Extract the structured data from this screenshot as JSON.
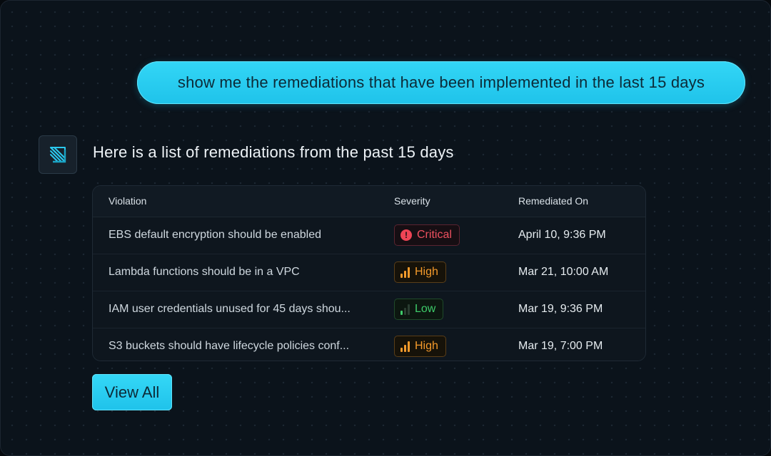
{
  "user_message": "show me the remediations that have been implemented in the last 15 days",
  "assistant": {
    "avatar_icon": "stripes-logo-icon",
    "message": "Here is a list of remediations from the past 15 days"
  },
  "table": {
    "columns": [
      "Violation",
      "Severity",
      "Remediated On"
    ],
    "rows": [
      {
        "violation": "EBS default encryption should be enabled",
        "severity": "Critical",
        "severity_icon": "alert-circle-icon",
        "remediated_on": "April 10, 9:36 PM"
      },
      {
        "violation": "Lambda functions should be in a VPC",
        "severity": "High",
        "severity_icon": "signal-high-icon",
        "remediated_on": "Mar 21, 10:00 AM"
      },
      {
        "violation": "IAM user credentials unused for 45 days shou...",
        "severity": "Low",
        "severity_icon": "signal-low-icon",
        "remediated_on": "Mar 19, 9:36 PM"
      },
      {
        "violation": "S3 buckets should have lifecycle policies conf...",
        "severity": "High",
        "severity_icon": "signal-high-icon",
        "remediated_on": "Mar 19, 7:00 PM"
      }
    ]
  },
  "view_all_label": "View All",
  "colors": {
    "accent": "#22c7ee",
    "critical": "#ef5160",
    "high": "#f49a2b",
    "low": "#3ecb6a",
    "background": "#0b131b"
  }
}
